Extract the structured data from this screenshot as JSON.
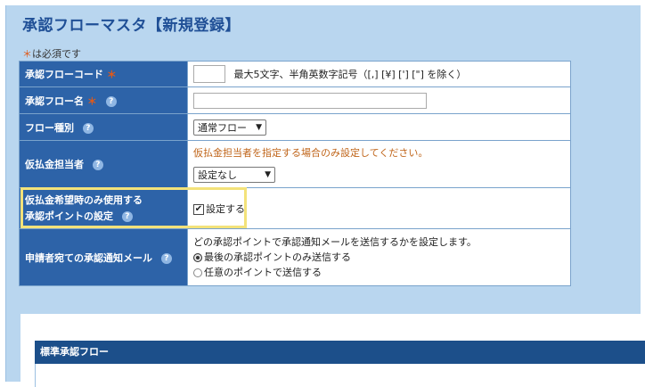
{
  "header": {
    "title": "承認フローマスタ【新規登録】"
  },
  "required_note": {
    "star": "＊",
    "text": "は必須です"
  },
  "fields": {
    "code": {
      "label": "承認フローコード",
      "star": "＊",
      "value": "",
      "hint": "最大5文字、半角英数字記号（[,] [¥] ['] [\"] を除く）"
    },
    "name": {
      "label": "承認フロー名",
      "star": "＊",
      "help": "?",
      "value": ""
    },
    "flow_type": {
      "label": "フロー種別",
      "help": "?",
      "selected": "通常フロー"
    },
    "advance_manager": {
      "label": "仮払金担当者",
      "help": "?",
      "note": "仮払金担当者を指定する場合のみ設定してください。",
      "selected": "設定なし"
    },
    "advance_point": {
      "label_line1": "仮払金希望時のみ使用する",
      "label_line2": "承認ポイントの設定",
      "help": "?",
      "checkbox_label": "設定する",
      "checked": true
    },
    "notify": {
      "label": "申請者宛ての承認通知メール",
      "help": "?",
      "description": "どの承認ポイントで承認通知メールを送信するかを設定します。",
      "options": [
        {
          "label": "最後の承認ポイントのみ送信する",
          "selected": true
        },
        {
          "label": "任意のポイントで送信する",
          "selected": false
        }
      ]
    }
  },
  "standard_flow": {
    "header": "標準承認フロー"
  },
  "colors": {
    "label_bg": "#2d63a8",
    "page_bg": "#b9d6ef",
    "title": "#1f4f96",
    "required": "#e05a1a",
    "note": "#c0651a",
    "highlight": "#f3e27a"
  }
}
